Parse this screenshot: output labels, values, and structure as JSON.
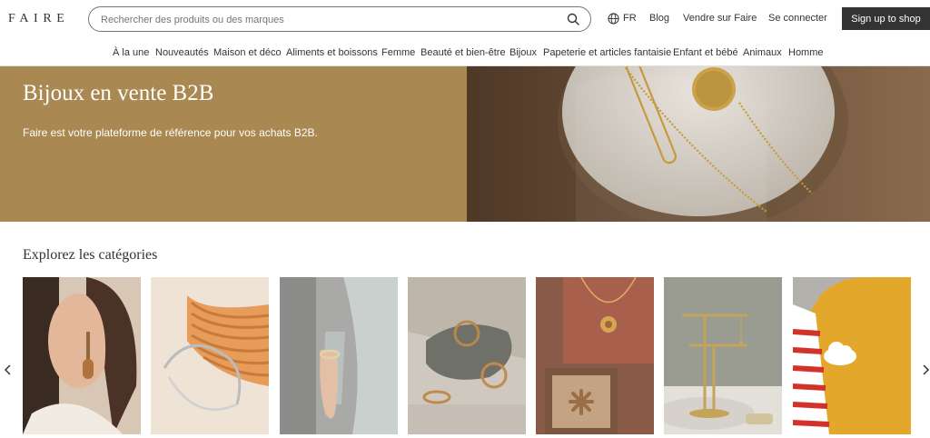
{
  "header": {
    "logo": "FAIRE",
    "search_placeholder": "Rechercher des produits ou des marques",
    "language": "FR",
    "blog": "Blog",
    "sell": "Vendre sur Faire",
    "login": "Se connecter",
    "signup": "Sign up to shop"
  },
  "nav": {
    "items": [
      "À la une",
      "Nouveautés",
      "Maison et déco",
      "Aliments et boissons",
      "Femme",
      "Beauté et bien-être",
      "Bijoux",
      "Papeterie et articles fantaisie",
      "Enfant et bébé",
      "Animaux",
      "Homme"
    ]
  },
  "hero": {
    "title": "Bijoux en vente B2B",
    "subtitle": "Faire est votre plateforme de référence pour vos achats B2B."
  },
  "categories": {
    "title": "Explorez les catégories"
  },
  "colors": {
    "hero_bg": "#a98851",
    "signup_bg": "#333333",
    "text": "#333333"
  }
}
